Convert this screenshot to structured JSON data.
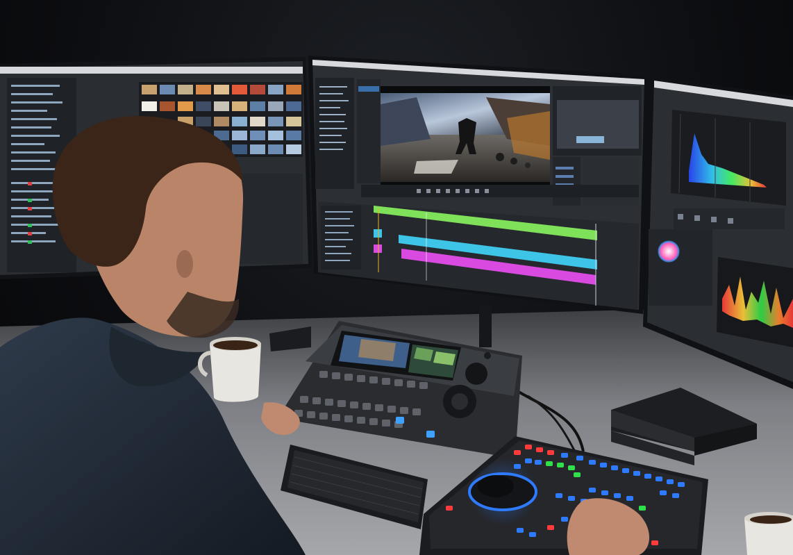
{
  "scene": {
    "description_tag": "video-editing-workstation",
    "colors": {
      "room": "#0c0d10",
      "desk": "#9a9ca0",
      "screen_bg": "#2b2e33",
      "panel_bg": "#1e2126",
      "timeline_green": "#7fe05a",
      "timeline_cyan": "#3ec4e6",
      "timeline_magenta": "#d94be0",
      "accent_blue": "#2f7bff",
      "accent_red": "#ff3b3b",
      "accent_green": "#2fe04a"
    },
    "left_monitor": {
      "thumbnail_rows": 5,
      "thumbnail_cols": 9
    },
    "center_monitor": {
      "preview": "city-street-action-shot",
      "tracks": [
        "green",
        "cyan",
        "magenta"
      ]
    },
    "right_monitor": {
      "scopes": [
        "histogram",
        "color-wheel",
        "audio-waveform"
      ]
    },
    "controllers": [
      "video-control-surface",
      "color-grading-panel",
      "keyboard"
    ],
    "objects": [
      "coffee-mug",
      "coffee-mug-small",
      "black-box-device"
    ]
  }
}
